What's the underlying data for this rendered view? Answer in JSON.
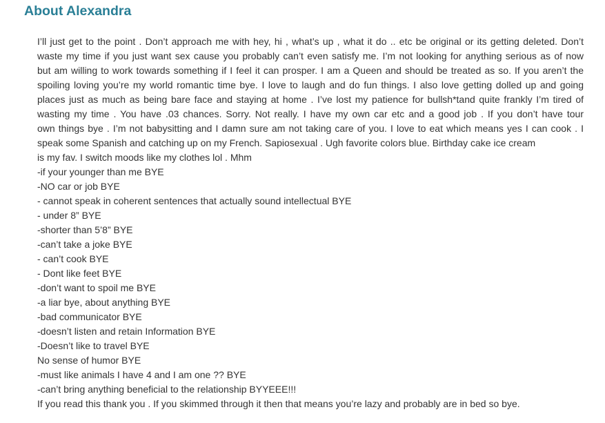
{
  "about": {
    "title": "About Alexandra",
    "intro_lines": [
      "I’ll just get to the point . Don’t approach me with hey, hi , what’s up , what it do .. etc be original or its getting deleted. Don’t",
      "waste my time if you just want sex cause you probably can’t even satisfy me. I’m not looking for anything serious as of now",
      "but am willing to work towards something if I feel it can prosper. I am a Queen and should be treated as so. If you aren’t the",
      "spoiling loving you’re my world romantic time bye. I love to laugh and do fun things. I also love getting dolled up and going",
      "places just as much as being bare face and staying at home . I’ve lost my patience for bullsh*tand quite frankly I’m tired of",
      "wasting my time . You have .03 chances. Sorry. Not really. I have my own car etc and a good job . If you don’t have tour",
      "own things bye . I’m not babysitting and I damn sure am not taking care of you. I love to eat which means yes I can cook . I",
      "speak some Spanish and catching up on my French. Sapiosexual . Ugh favorite colors blue. Birthday cake ice cream",
      "is my fav. I switch moods like my clothes lol . Mhm"
    ],
    "list_lines": [
      "-if your younger than me BYE",
      "-NO car or job BYE",
      "- cannot speak in coherent sentences that actually sound intellectual BYE",
      "- under 8” BYE",
      "-shorter than 5’8” BYE",
      "-can’t take a joke BYE",
      "- can’t cook BYE",
      "- Dont like feet BYE",
      "-don’t want to spoil me BYE",
      "-a liar bye, about anything BYE",
      "-bad communicator BYE",
      "-doesn’t listen and retain Information BYE",
      "-Doesn’t like to travel BYE",
      "No sense of humor BYE",
      "-must like animals I have 4 and I am one ?? BYE",
      "-can’t bring anything beneficial to the relationship BYYEEE!!!",
      "If you read this thank you . If you skimmed through it then that means you’re lazy and probably are in bed so bye."
    ]
  }
}
